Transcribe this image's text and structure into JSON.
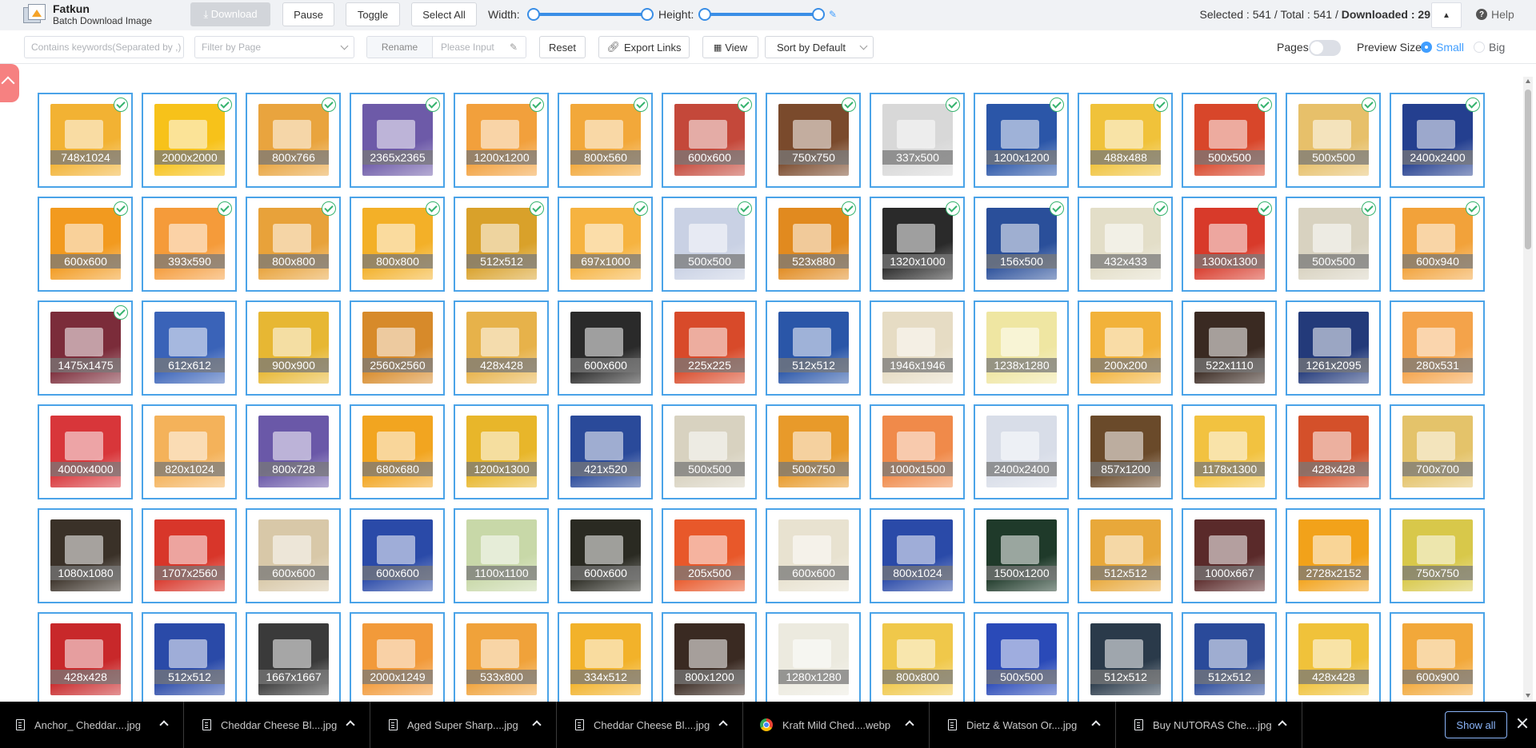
{
  "app": {
    "name": "Fatkun",
    "subtitle": "Batch Download Image"
  },
  "toolbar": {
    "download": "⤓ Download",
    "pause": "Pause",
    "toggle": "Toggle",
    "select_all": "Select All",
    "width_label": "Width:",
    "height_label": "Height:"
  },
  "stats": {
    "selected_label": "Selected : ",
    "selected": "541",
    "sep": " / Total : ",
    "total": "541",
    "sep2": " / ",
    "downloaded_label": "Downloaded : ",
    "downloaded": "29"
  },
  "help": "Help",
  "filters": {
    "keyword_placeholder": "Contains keywords(Separated by ,)",
    "page_placeholder": "Filter by Page",
    "rename": "Rename",
    "rename_placeholder": "Please Input",
    "reset": "Reset",
    "export": "Export Links",
    "view": "View",
    "sort": "Sort by Default",
    "pages": "Pages",
    "preview_size": "Preview Size",
    "small": "Small",
    "big": "Big"
  },
  "colors": {
    "accent": "#409eff",
    "card_border": "#4aa3e8",
    "check": "#36b36e"
  },
  "images": [
    {
      "dim": "748x1024",
      "c": "#f2b233",
      "chk": true
    },
    {
      "dim": "2000x2000",
      "c": "#f7c21a",
      "chk": true
    },
    {
      "dim": "800x766",
      "c": "#e9a43e",
      "chk": true
    },
    {
      "dim": "2365x2365",
      "c": "#6d5aa8",
      "chk": true
    },
    {
      "dim": "1200x1200",
      "c": "#f2a03c",
      "chk": true
    },
    {
      "dim": "800x560",
      "c": "#f2a83a",
      "chk": true
    },
    {
      "dim": "600x600",
      "c": "#c4483a",
      "chk": true
    },
    {
      "dim": "750x750",
      "c": "#7a4a2c",
      "chk": true
    },
    {
      "dim": "337x500",
      "c": "#d8d8d8",
      "chk": true
    },
    {
      "dim": "1200x1200",
      "c": "#2b56a8",
      "chk": true
    },
    {
      "dim": "488x488",
      "c": "#f0c23a",
      "chk": true
    },
    {
      "dim": "500x500",
      "c": "#d8462a",
      "chk": true
    },
    {
      "dim": "500x500",
      "c": "#e7c06a",
      "chk": true
    },
    {
      "dim": "2400x2400",
      "c": "#243f8f",
      "chk": true
    },
    {
      "dim": "600x600",
      "c": "#f29a1f",
      "chk": true
    },
    {
      "dim": "393x590",
      "c": "#f59b3a",
      "chk": true
    },
    {
      "dim": "800x800",
      "c": "#e8a23a",
      "chk": true
    },
    {
      "dim": "800x800",
      "c": "#f3b028",
      "chk": true
    },
    {
      "dim": "512x512",
      "c": "#d9a12a",
      "chk": true
    },
    {
      "dim": "697x1000",
      "c": "#f6b340",
      "chk": true
    },
    {
      "dim": "500x500",
      "c": "#c9d1e4",
      "chk": true
    },
    {
      "dim": "523x880",
      "c": "#e18a1f",
      "chk": true
    },
    {
      "dim": "1320x1000",
      "c": "#2a2a2a",
      "chk": true
    },
    {
      "dim": "156x500",
      "c": "#2a4f9a",
      "chk": true
    },
    {
      "dim": "432x433",
      "c": "#e3dec8",
      "chk": true
    },
    {
      "dim": "1300x1300",
      "c": "#d83a2a",
      "chk": true
    },
    {
      "dim": "500x500",
      "c": "#d8d2c0",
      "chk": true
    },
    {
      "dim": "600x940",
      "c": "#f2a23a",
      "chk": true
    },
    {
      "dim": "1475x1475",
      "c": "#7b2c3a",
      "chk": true
    },
    {
      "dim": "612x612",
      "c": "#3a63b8",
      "chk": false
    },
    {
      "dim": "900x900",
      "c": "#e7b733",
      "chk": false
    },
    {
      "dim": "2560x2560",
      "c": "#d78a2a",
      "chk": false
    },
    {
      "dim": "428x428",
      "c": "#e7b24a",
      "chk": false
    },
    {
      "dim": "600x600",
      "c": "#2a2a2a",
      "chk": false
    },
    {
      "dim": "225x225",
      "c": "#d84a2a",
      "chk": false
    },
    {
      "dim": "512x512",
      "c": "#2a56a8",
      "chk": false
    },
    {
      "dim": "1946x1946",
      "c": "#e6dcc4",
      "chk": false
    },
    {
      "dim": "1238x1280",
      "c": "#efe6a2",
      "chk": false
    },
    {
      "dim": "200x200",
      "c": "#f2b23a",
      "chk": false
    },
    {
      "dim": "522x1110",
      "c": "#3a2a22",
      "chk": false
    },
    {
      "dim": "1261x2095",
      "c": "#233a7a",
      "chk": false
    },
    {
      "dim": "280x531",
      "c": "#f4a34a",
      "chk": false
    },
    {
      "dim": "4000x4000",
      "c": "#d8363a",
      "chk": false
    },
    {
      "dim": "820x1024",
      "c": "#f4b25a",
      "chk": false
    },
    {
      "dim": "800x728",
      "c": "#6a58a8",
      "chk": false
    },
    {
      "dim": "680x680",
      "c": "#f2a520",
      "chk": false
    },
    {
      "dim": "1200x1300",
      "c": "#e8b62a",
      "chk": false
    },
    {
      "dim": "421x520",
      "c": "#2a4a9a",
      "chk": false
    },
    {
      "dim": "500x500",
      "c": "#d8d2c0",
      "chk": false
    },
    {
      "dim": "500x750",
      "c": "#e89a2a",
      "chk": false
    },
    {
      "dim": "1000x1500",
      "c": "#f08a4a",
      "chk": false
    },
    {
      "dim": "2400x2400",
      "c": "#d8dde8",
      "chk": false
    },
    {
      "dim": "857x1200",
      "c": "#6a4a2a",
      "chk": false
    },
    {
      "dim": "1178x1300",
      "c": "#f2c240",
      "chk": false
    },
    {
      "dim": "428x428",
      "c": "#d4502a",
      "chk": false
    },
    {
      "dim": "700x700",
      "c": "#e4c36a",
      "chk": false
    },
    {
      "dim": "1080x1080",
      "c": "#3a3128",
      "chk": false
    },
    {
      "dim": "1707x2560",
      "c": "#d8362a",
      "chk": false
    },
    {
      "dim": "600x600",
      "c": "#d8c8a8",
      "chk": false
    },
    {
      "dim": "600x600",
      "c": "#2a4aa8",
      "chk": false
    },
    {
      "dim": "1100x1100",
      "c": "#c8d8a8",
      "chk": false
    },
    {
      "dim": "600x600",
      "c": "#2a2a22",
      "chk": false
    },
    {
      "dim": "205x500",
      "c": "#e8582a",
      "chk": false
    },
    {
      "dim": "600x600",
      "c": "#e8e2d0",
      "chk": false
    },
    {
      "dim": "800x1024",
      "c": "#2a4aa8",
      "chk": false
    },
    {
      "dim": "1500x1200",
      "c": "#1f3a2a",
      "chk": false
    },
    {
      "dim": "512x512",
      "c": "#e8a83a",
      "chk": false
    },
    {
      "dim": "1000x667",
      "c": "#5a2a2a",
      "chk": false
    },
    {
      "dim": "2728x2152",
      "c": "#f2a21a",
      "chk": false
    },
    {
      "dim": "750x750",
      "c": "#d8c84a",
      "chk": false
    },
    {
      "dim": "428x428",
      "c": "#c8282a",
      "chk": false
    },
    {
      "dim": "512x512",
      "c": "#2a4aa8",
      "chk": false
    },
    {
      "dim": "1667x1667",
      "c": "#3a3a3a",
      "chk": false
    },
    {
      "dim": "2000x1249",
      "c": "#f29a3a",
      "chk": false
    },
    {
      "dim": "533x800",
      "c": "#f0a23a",
      "chk": false
    },
    {
      "dim": "334x512",
      "c": "#f2b22a",
      "chk": false
    },
    {
      "dim": "800x1200",
      "c": "#3a2a22",
      "chk": false
    },
    {
      "dim": "1280x1280",
      "c": "#eceadf",
      "chk": false
    },
    {
      "dim": "800x800",
      "c": "#f0c84a",
      "chk": false
    },
    {
      "dim": "500x500",
      "c": "#2a4ab8",
      "chk": false
    },
    {
      "dim": "512x512",
      "c": "#2a3a4a",
      "chk": false
    },
    {
      "dim": "512x512",
      "c": "#2a4a9a",
      "chk": false
    },
    {
      "dim": "428x428",
      "c": "#f0c23a",
      "chk": false
    },
    {
      "dim": "600x900",
      "c": "#f2a83a",
      "chk": false
    }
  ],
  "downloads": [
    {
      "name": "Anchor_ Cheddar....jpg",
      "icon": "file"
    },
    {
      "name": "Cheddar Cheese Bl....jpg",
      "icon": "file"
    },
    {
      "name": "Aged Super Sharp....jpg",
      "icon": "file"
    },
    {
      "name": "Cheddar Cheese Bl....jpg",
      "icon": "file"
    },
    {
      "name": "Kraft Mild Ched....webp",
      "icon": "chrome"
    },
    {
      "name": "Dietz & Watson Or....jpg",
      "icon": "file"
    },
    {
      "name": "Buy NUTORAS Che....jpg",
      "icon": "file"
    }
  ],
  "shelf": {
    "show_all": "Show all"
  }
}
